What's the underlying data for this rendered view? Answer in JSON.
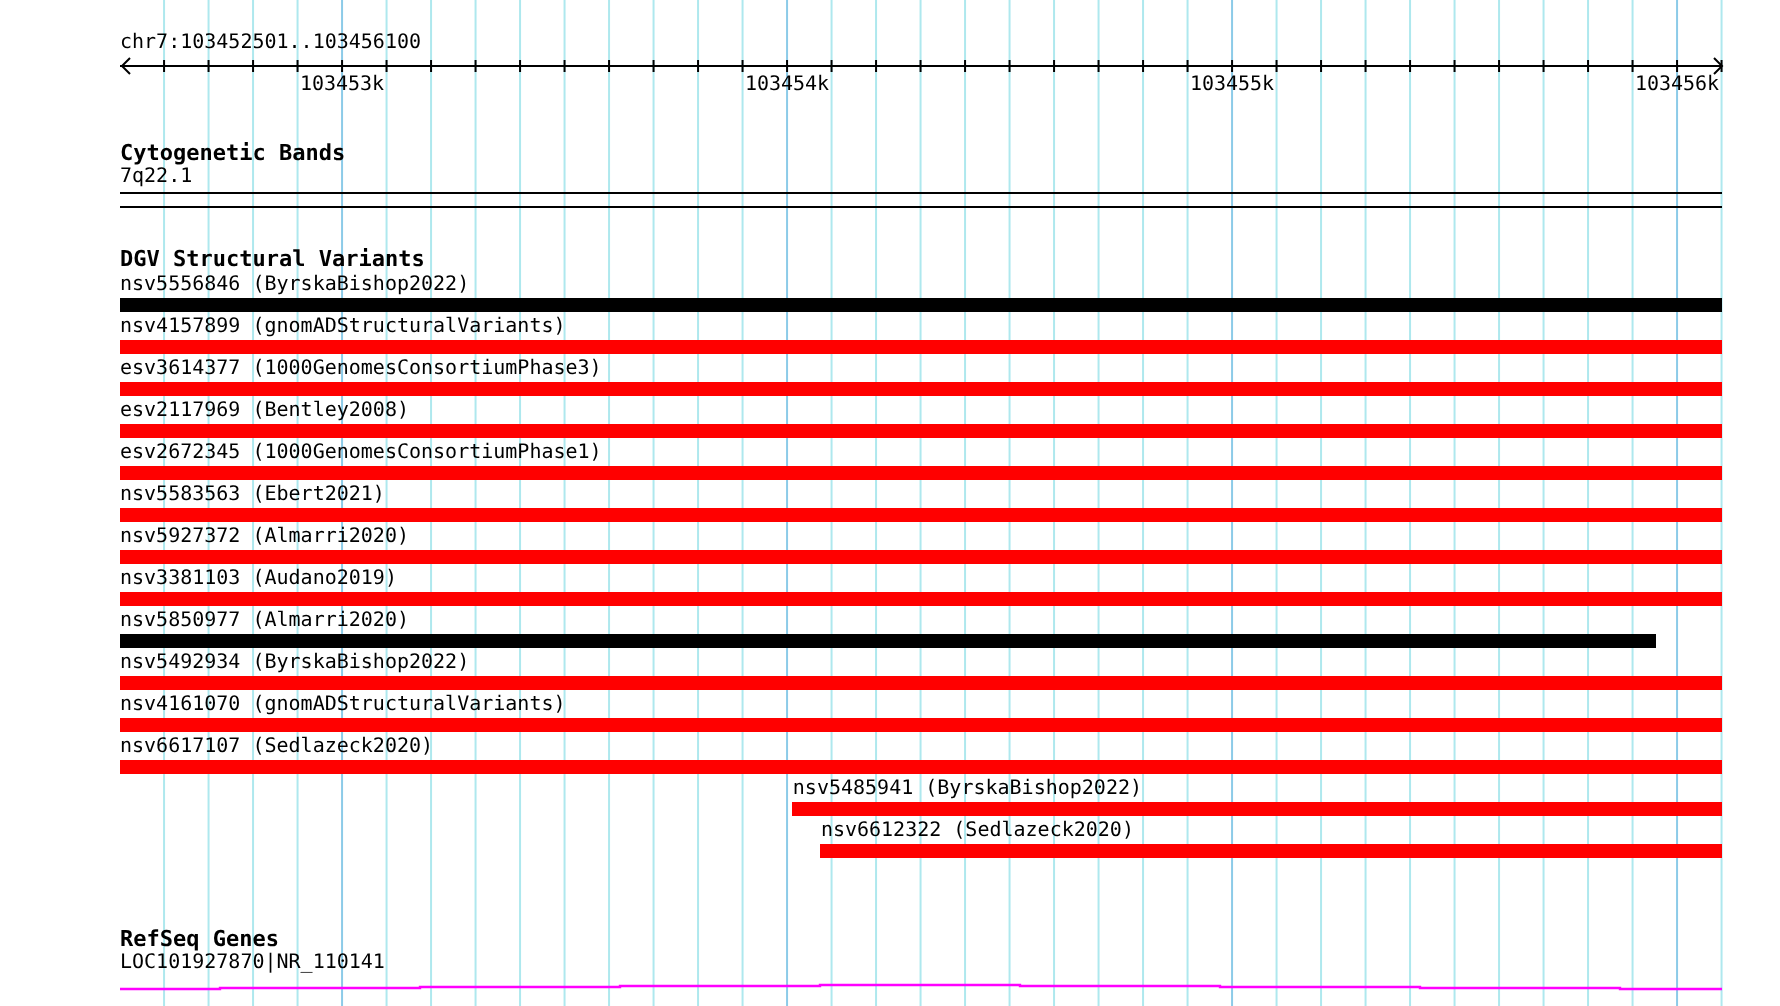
{
  "ruler": {
    "location": "chr7:103452501..103456100",
    "ticks": [
      "103453k",
      "103454k",
      "103455k",
      "103456k"
    ]
  },
  "cytogenetic_bands": {
    "title": "Cytogenetic Bands",
    "band": "7q22.1"
  },
  "dgv_structural_variants": {
    "title": "DGV Structural Variants",
    "variants": [
      {
        "label": "nsv5556846 (ByrskaBishop2022)",
        "color": "#000000"
      },
      {
        "label": "nsv4157899 (gnomADStructuralVariants)",
        "color": "#ff0000"
      },
      {
        "label": "esv3614377 (1000GenomesConsortiumPhase3)",
        "color": "#ff0000"
      },
      {
        "label": "esv2117969 (Bentley2008)",
        "color": "#ff0000"
      },
      {
        "label": "esv2672345 (1000GenomesConsortiumPhase1)",
        "color": "#ff0000"
      },
      {
        "label": "nsv5583563 (Ebert2021)",
        "color": "#ff0000"
      },
      {
        "label": "nsv5927372 (Almarri2020)",
        "color": "#ff0000"
      },
      {
        "label": "nsv3381103 (Audano2019)",
        "color": "#ff0000"
      },
      {
        "label": "nsv5850977 (Almarri2020)",
        "color": "#000000"
      },
      {
        "label": "nsv5492934 (ByrskaBishop2022)",
        "color": "#ff0000"
      },
      {
        "label": "nsv4161070 (gnomADStructuralVariants)",
        "color": "#ff0000"
      },
      {
        "label": "nsv6617107 (Sedlazeck2020)",
        "color": "#ff0000"
      },
      {
        "label": "nsv5485941 (ByrskaBishop2022)",
        "color": "#ff0000"
      },
      {
        "label": "nsv6612322 (Sedlazeck2020)",
        "color": "#ff0000"
      }
    ]
  },
  "refseq_genes": {
    "title": "RefSeq Genes",
    "gene": "LOC101927870|NR_110141"
  }
}
